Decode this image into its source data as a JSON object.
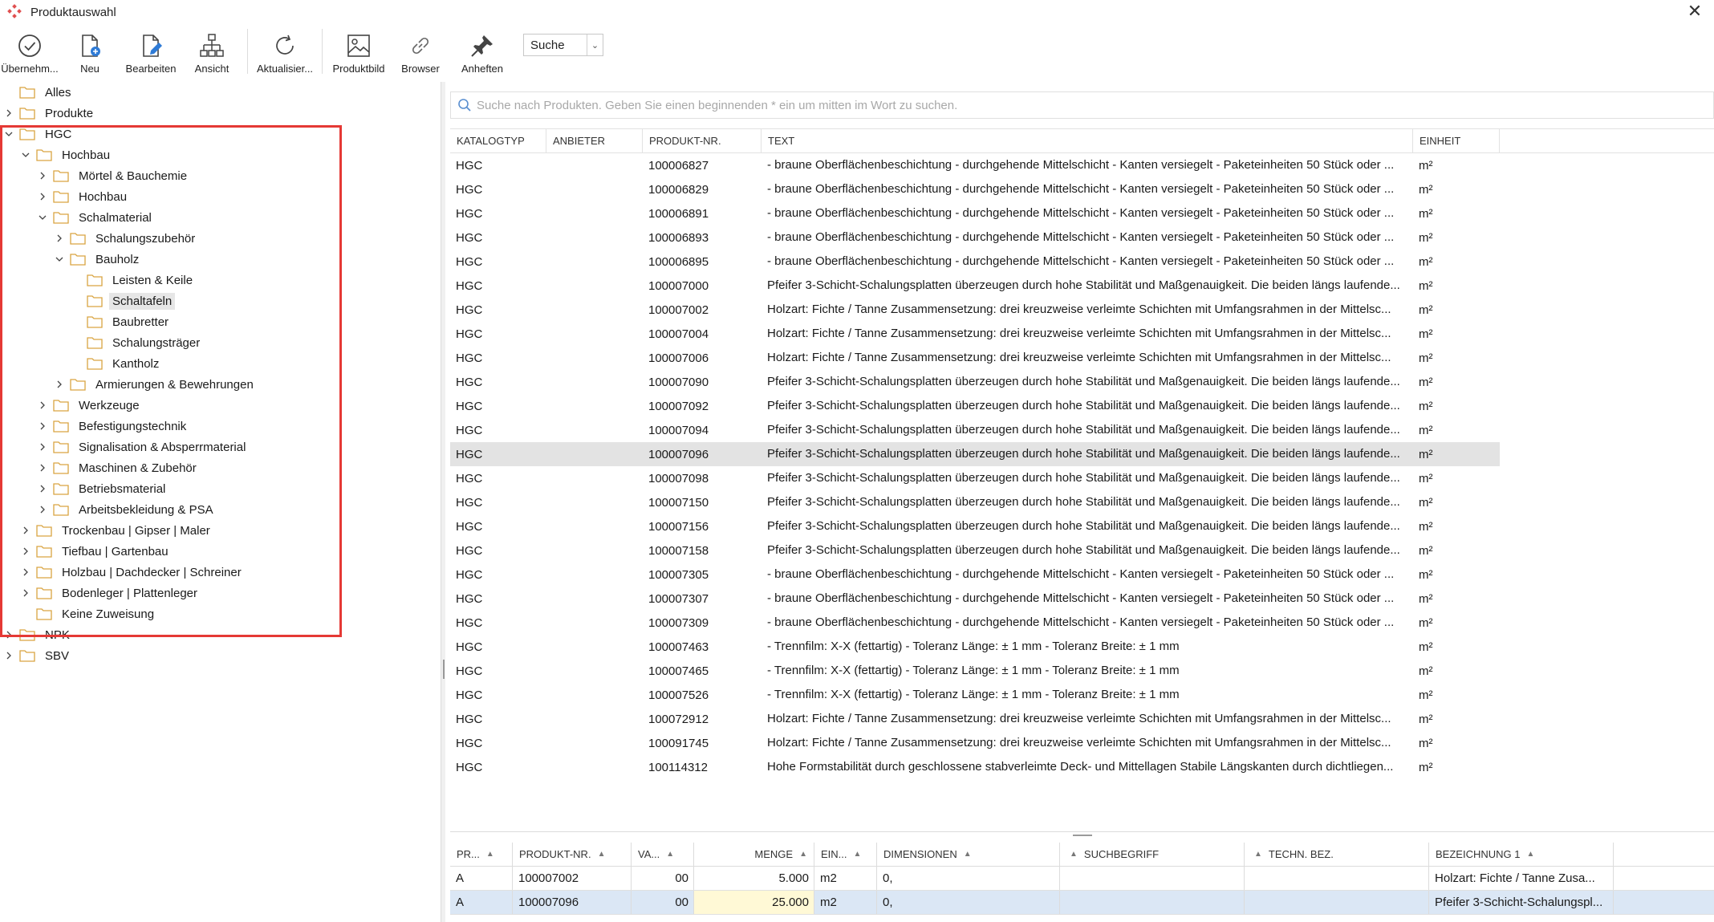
{
  "window": {
    "title": "Produktauswahl",
    "accent": "#e53935"
  },
  "toolbar": {
    "buttons": [
      {
        "label": "Übernehm...",
        "icon": "check-circle-icon"
      },
      {
        "label": "Neu",
        "icon": "new-document-icon"
      },
      {
        "label": "Bearbeiten",
        "icon": "edit-document-icon"
      },
      {
        "label": "Ansicht",
        "icon": "hierarchy-icon"
      },
      {
        "label": "Aktualisier...",
        "icon": "refresh-icon"
      },
      {
        "label": "Produktbild",
        "icon": "image-icon"
      },
      {
        "label": "Browser",
        "icon": "link-icon"
      },
      {
        "label": "Anheften",
        "icon": "pin-icon"
      }
    ],
    "search_mode": "Suche"
  },
  "tree": {
    "items": [
      {
        "label": "Alles",
        "chevron": "none"
      },
      {
        "label": "Produkte",
        "chevron": "right"
      },
      {
        "label": "HGC",
        "chevron": "down"
      },
      {
        "label": "Hochbau",
        "chevron": "down"
      },
      {
        "label": "Mörtel & Bauchemie",
        "chevron": "right"
      },
      {
        "label": "Hochbau",
        "chevron": "right"
      },
      {
        "label": "Schalmaterial",
        "chevron": "down"
      },
      {
        "label": "Schalungszubehör",
        "chevron": "right"
      },
      {
        "label": "Bauholz",
        "chevron": "down"
      },
      {
        "label": "Leisten & Keile",
        "chevron": "none"
      },
      {
        "label": "Schaltafeln",
        "chevron": "none",
        "selected": true
      },
      {
        "label": "Baubretter",
        "chevron": "none"
      },
      {
        "label": "Schalungsträger",
        "chevron": "none"
      },
      {
        "label": "Kantholz",
        "chevron": "none"
      },
      {
        "label": "Armierungen & Bewehrungen",
        "chevron": "right"
      },
      {
        "label": "Werkzeuge",
        "chevron": "right"
      },
      {
        "label": "Befestigungstechnik",
        "chevron": "right"
      },
      {
        "label": "Signalisation & Absperrmaterial",
        "chevron": "right"
      },
      {
        "label": "Maschinen & Zubehör",
        "chevron": "right"
      },
      {
        "label": "Betriebsmaterial",
        "chevron": "right"
      },
      {
        "label": "Arbeitsbekleidung & PSA",
        "chevron": "right"
      },
      {
        "label": "Trockenbau | Gipser | Maler",
        "chevron": "right"
      },
      {
        "label": "Tiefbau | Gartenbau",
        "chevron": "right"
      },
      {
        "label": "Holzbau | Dachdecker | Schreiner",
        "chevron": "right"
      },
      {
        "label": "Bodenleger | Plattenleger",
        "chevron": "right"
      },
      {
        "label": "Keine Zuweisung",
        "chevron": "none"
      },
      {
        "label": "NPK",
        "chevron": "right"
      },
      {
        "label": "SBV",
        "chevron": "right"
      }
    ]
  },
  "search": {
    "placeholder": "Suche nach Produkten. Geben Sie einen beginnenden * ein um mitten im Wort zu suchen."
  },
  "products": {
    "columns": [
      "KATALOGTYP",
      "ANBIETER",
      "PRODUKT-NR.",
      "TEXT",
      "EINHEIT"
    ],
    "rows": [
      {
        "typ": "HGC",
        "anbieter": "",
        "nr": "100006827",
        "text": "- braune Oberflächenbeschichtung - durchgehende Mittelschicht - Kanten versiegelt - Paketeinheiten 50 Stück oder ...",
        "einheit": "m²"
      },
      {
        "typ": "HGC",
        "anbieter": "",
        "nr": "100006829",
        "text": "- braune Oberflächenbeschichtung - durchgehende Mittelschicht - Kanten versiegelt - Paketeinheiten 50 Stück oder ...",
        "einheit": "m²"
      },
      {
        "typ": "HGC",
        "anbieter": "",
        "nr": "100006891",
        "text": "- braune Oberflächenbeschichtung - durchgehende Mittelschicht - Kanten versiegelt - Paketeinheiten 50 Stück oder ...",
        "einheit": "m²"
      },
      {
        "typ": "HGC",
        "anbieter": "",
        "nr": "100006893",
        "text": "- braune Oberflächenbeschichtung - durchgehende Mittelschicht - Kanten versiegelt - Paketeinheiten 50 Stück oder ...",
        "einheit": "m²"
      },
      {
        "typ": "HGC",
        "anbieter": "",
        "nr": "100006895",
        "text": "- braune Oberflächenbeschichtung - durchgehende Mittelschicht - Kanten versiegelt - Paketeinheiten 50 Stück oder ...",
        "einheit": "m²"
      },
      {
        "typ": "HGC",
        "anbieter": "",
        "nr": "100007000",
        "text": "Pfeifer 3-Schicht-Schalungsplatten überzeugen durch hohe Stabilität und Maßgenauigkeit. Die beiden längs laufende...",
        "einheit": "m²"
      },
      {
        "typ": "HGC",
        "anbieter": "",
        "nr": "100007002",
        "text": "Holzart: Fichte / Tanne Zusammensetzung: drei kreuzweise verleimte Schichten mit Umfangsrahmen in der Mittelsc...",
        "einheit": "m²"
      },
      {
        "typ": "HGC",
        "anbieter": "",
        "nr": "100007004",
        "text": "Holzart: Fichte / Tanne Zusammensetzung: drei kreuzweise verleimte Schichten mit Umfangsrahmen in der Mittelsc...",
        "einheit": "m²"
      },
      {
        "typ": "HGC",
        "anbieter": "",
        "nr": "100007006",
        "text": "Holzart: Fichte / Tanne Zusammensetzung: drei kreuzweise verleimte Schichten mit Umfangsrahmen in der Mittelsc...",
        "einheit": "m²"
      },
      {
        "typ": "HGC",
        "anbieter": "",
        "nr": "100007090",
        "text": "Pfeifer 3-Schicht-Schalungsplatten überzeugen durch hohe Stabilität und Maßgenauigkeit. Die beiden längs laufende...",
        "einheit": "m²"
      },
      {
        "typ": "HGC",
        "anbieter": "",
        "nr": "100007092",
        "text": "Pfeifer 3-Schicht-Schalungsplatten überzeugen durch hohe Stabilität und Maßgenauigkeit. Die beiden längs laufende...",
        "einheit": "m²"
      },
      {
        "typ": "HGC",
        "anbieter": "",
        "nr": "100007094",
        "text": "Pfeifer 3-Schicht-Schalungsplatten überzeugen durch hohe Stabilität und Maßgenauigkeit. Die beiden längs laufende...",
        "einheit": "m²"
      },
      {
        "typ": "HGC",
        "anbieter": "",
        "nr": "100007096",
        "text": "Pfeifer 3-Schicht-Schalungsplatten überzeugen durch hohe Stabilität und Maßgenauigkeit. Die beiden längs laufende...",
        "einheit": "m²",
        "selected": true
      },
      {
        "typ": "HGC",
        "anbieter": "",
        "nr": "100007098",
        "text": "Pfeifer 3-Schicht-Schalungsplatten überzeugen durch hohe Stabilität und Maßgenauigkeit. Die beiden längs laufende...",
        "einheit": "m²"
      },
      {
        "typ": "HGC",
        "anbieter": "",
        "nr": "100007150",
        "text": "Pfeifer 3-Schicht-Schalungsplatten überzeugen durch hohe Stabilität und Maßgenauigkeit. Die beiden längs laufende...",
        "einheit": "m²"
      },
      {
        "typ": "HGC",
        "anbieter": "",
        "nr": "100007156",
        "text": "Pfeifer 3-Schicht-Schalungsplatten überzeugen durch hohe Stabilität und Maßgenauigkeit. Die beiden längs laufende...",
        "einheit": "m²"
      },
      {
        "typ": "HGC",
        "anbieter": "",
        "nr": "100007158",
        "text": "Pfeifer 3-Schicht-Schalungsplatten überzeugen durch hohe Stabilität und Maßgenauigkeit. Die beiden längs laufende...",
        "einheit": "m²"
      },
      {
        "typ": "HGC",
        "anbieter": "",
        "nr": "100007305",
        "text": "- braune Oberflächenbeschichtung - durchgehende Mittelschicht - Kanten versiegelt - Paketeinheiten 50 Stück oder ...",
        "einheit": "m²"
      },
      {
        "typ": "HGC",
        "anbieter": "",
        "nr": "100007307",
        "text": "- braune Oberflächenbeschichtung - durchgehende Mittelschicht - Kanten versiegelt - Paketeinheiten 50 Stück oder ...",
        "einheit": "m²"
      },
      {
        "typ": "HGC",
        "anbieter": "",
        "nr": "100007309",
        "text": "- braune Oberflächenbeschichtung - durchgehende Mittelschicht - Kanten versiegelt - Paketeinheiten 50 Stück oder ...",
        "einheit": "m²"
      },
      {
        "typ": "HGC",
        "anbieter": "",
        "nr": "100007463",
        "text": "- Trennfilm: X-X (fettartig) - Toleranz Länge: ± 1 mm - Toleranz Breite: ± 1 mm",
        "einheit": "m²"
      },
      {
        "typ": "HGC",
        "anbieter": "",
        "nr": "100007465",
        "text": "- Trennfilm: X-X (fettartig) - Toleranz Länge: ± 1 mm - Toleranz Breite: ± 1 mm",
        "einheit": "m²"
      },
      {
        "typ": "HGC",
        "anbieter": "",
        "nr": "100007526",
        "text": "- Trennfilm: X-X (fettartig) - Toleranz Länge: ± 1 mm - Toleranz Breite: ± 1 mm",
        "einheit": "m²"
      },
      {
        "typ": "HGC",
        "anbieter": "",
        "nr": "100072912",
        "text": "Holzart: Fichte / Tanne Zusammensetzung: drei kreuzweise verleimte Schichten mit Umfangsrahmen in der Mittelsc...",
        "einheit": "m²"
      },
      {
        "typ": "HGC",
        "anbieter": "",
        "nr": "100091745",
        "text": "Holzart: Fichte / Tanne Zusammensetzung: drei kreuzweise verleimte Schichten mit Umfangsrahmen in der Mittelsc...",
        "einheit": "m²"
      },
      {
        "typ": "HGC",
        "anbieter": "",
        "nr": "100114312",
        "text": "Hohe Formstabilität durch geschlossene stabverleimte Deck- und Mittellagen Stabile Längskanten durch dichtliegen...",
        "einheit": "m²"
      }
    ]
  },
  "selection": {
    "columns": [
      "PR...",
      "PRODUKT-NR.",
      "VA...",
      "MENGE",
      "EIN...",
      "DIMENSIONEN",
      "SUCHBEGRIFF",
      "TECHN. BEZ.",
      "BEZEICHNUNG 1"
    ],
    "rows": [
      {
        "pr": "A",
        "nr": "100007002",
        "va": "00",
        "menge": "5.000",
        "ein": "m2",
        "dim": "0,",
        "such": "",
        "techn": "",
        "bez": "Holzart: Fichte / Tanne Zusa..."
      },
      {
        "pr": "A",
        "nr": "100007096",
        "va": "00",
        "menge": "25.000",
        "ein": "m2",
        "dim": "0,",
        "such": "",
        "techn": "",
        "bez": "Pfeifer 3-Schicht-Schalungspl...",
        "selected": true
      }
    ]
  }
}
